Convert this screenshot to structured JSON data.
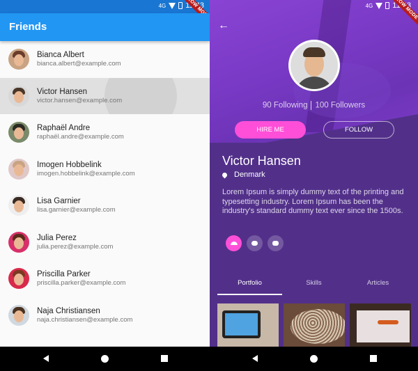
{
  "status_bar": {
    "time": "11:43",
    "network": "4G",
    "debug_banner": "SLOW MODE"
  },
  "friends_screen": {
    "title": "Friends",
    "contacts": [
      {
        "name": "Bianca Albert",
        "email": "bianca.albert@example.com"
      },
      {
        "name": "Victor Hansen",
        "email": "victor.hansen@example.com"
      },
      {
        "name": "Raphaël Andre",
        "email": "raphaël.andre@example.com"
      },
      {
        "name": "Imogen Hobbelink",
        "email": "imogen.hobbelink@example.com"
      },
      {
        "name": "Lisa Garnier",
        "email": "lisa.garnier@example.com"
      },
      {
        "name": "Julia Perez",
        "email": "julia.perez@example.com"
      },
      {
        "name": "Priscilla Parker",
        "email": "priscilla.parker@example.com"
      },
      {
        "name": "Naja Christiansen",
        "email": "naja.christiansen@example.com"
      }
    ]
  },
  "profile_screen": {
    "following": "90 Following",
    "followers": "100 Followers",
    "hire_label": "HIRE ME",
    "follow_label": "FOLLOW",
    "name": "Victor Hansen",
    "location": "Denmark",
    "description": "Lorem Ipsum is simply dummy text of the printing and typesetting industry. Lorem Ipsum has been the industry's standard dummy text ever since the 1500s.",
    "tabs": [
      "Portfolio",
      "Skills",
      "Articles"
    ],
    "selected_tab": "Portfolio",
    "social_icons": [
      "dribbble-icon",
      "cloud-icon",
      "camera-icon"
    ]
  },
  "colors": {
    "appbar": "#2196f3",
    "accent_pink": "#ff4fd8",
    "profile_bg": "#52308a"
  }
}
